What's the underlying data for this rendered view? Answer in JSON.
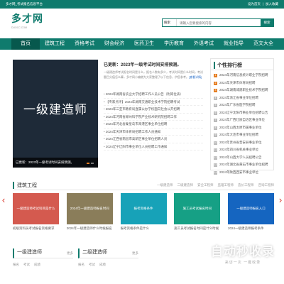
{
  "topbar": {
    "left": "多才网_考试报名信息平台",
    "links": [
      "设为首页",
      "|",
      "加入收藏"
    ]
  },
  "site": {
    "logo": "多才网",
    "domain": "DUOCC.COM"
  },
  "search": {
    "category": "搜索",
    "placeholder": "请输入您要搜索的内容",
    "button": "搜索"
  },
  "nav": [
    "首页",
    "建筑工程",
    "资格考试",
    "财会经济",
    "医药卫生",
    "学历教育",
    "外语考试",
    "就业指导",
    "范文大全"
  ],
  "banner": {
    "image_text": "一级建造师",
    "caption": "已更新：2023年一级考试时间安排预测。"
  },
  "headline": {
    "title": "已更新：2023年一级考试时间安排预测。",
    "summary": "一级建造师考试报名时间是什么，报名人数有多少，考试时间是什么时间，考试题目分值怎么算，多才网小编就为大家整理了以下信息，供您参考。",
    "more": "[查看详情]"
  },
  "news": [
    "2024年湖南省农业大学招聘工作人员公告（附岗位表）",
    "【专家点评】2024年湖南交通职业技术学院招聘考试",
    "2024年三亚市教育局直属公办学校面向社会公开招聘",
    "2024年河南省郑州科学院产业技术研究院招聘工作",
    "2024年河北省秦皇岛市海港区事业单位招聘",
    "2024年天津市体育局招聘工作人员通知",
    "2024江西省南昌市高新区事业单位招聘人员",
    "2024辽宁辽阳市事业单位人员招聘工作通知"
  ],
  "rank": {
    "title": "个性排行榜",
    "items": [
      "2024年河南信息统计职业学院招聘",
      "2024年天津市体育局招聘",
      "2024年湖南城建职业技术学院招聘",
      "2024年浙江省事业单位招聘",
      "2024年广东省医学院招聘",
      "2024辽宁沈阳市事业单位招聘公告",
      "2024年广西壮族自治区事业单位",
      "2024年山西太原市属事业单位",
      "2024年大连市事业单位招聘",
      "2024年贵州省普安县事业单位",
      "2024年四川省机关事业单位",
      "2024年山西大学人员招聘公告",
      "2024年湖北省黄石市事业单位招聘",
      "2024年陕西西安市事业单位"
    ]
  },
  "section": {
    "title": "建筑工程",
    "tags": [
      "一级建造师",
      "二级建造师",
      "安全工程师",
      "监理工程师",
      "造价工程师",
      "咨询工程师"
    ]
  },
  "cards": [
    {
      "img": "一级建造师考试科目是什么",
      "caption": "初级资料员考试报名资格要求",
      "color": "#d45a4f"
    },
    {
      "img": "2024年一级建造师报名时间",
      "caption": "2024年一级建造师什么时候报名",
      "color": "#8a7d5a"
    },
    {
      "img": "报考资格条件",
      "caption": "报考资格条件是什么",
      "color": "#17a2b8"
    },
    {
      "img": "施工员考试报名时间",
      "caption": "施工员考试报名时间是什么时候",
      "color": "#16a085"
    },
    {
      "img": "一级建造师报名入口",
      "caption": "2024一级建造师报考条件",
      "color": "#1565c0"
    }
  ],
  "watermark": {
    "line1": "自动秒收录",
    "line2": "来访一次 一键收录"
  },
  "subsections": [
    {
      "title": "一级建造师",
      "tabs": [
        "报名",
        "考试",
        "成绩"
      ],
      "more": "更多"
    },
    {
      "title": "二级建造师",
      "tabs": [
        "报名",
        "考试",
        "成绩"
      ],
      "more": "更多"
    }
  ],
  "colors": {
    "primary": "#0f7b6d",
    "accent": "#e67e22"
  }
}
